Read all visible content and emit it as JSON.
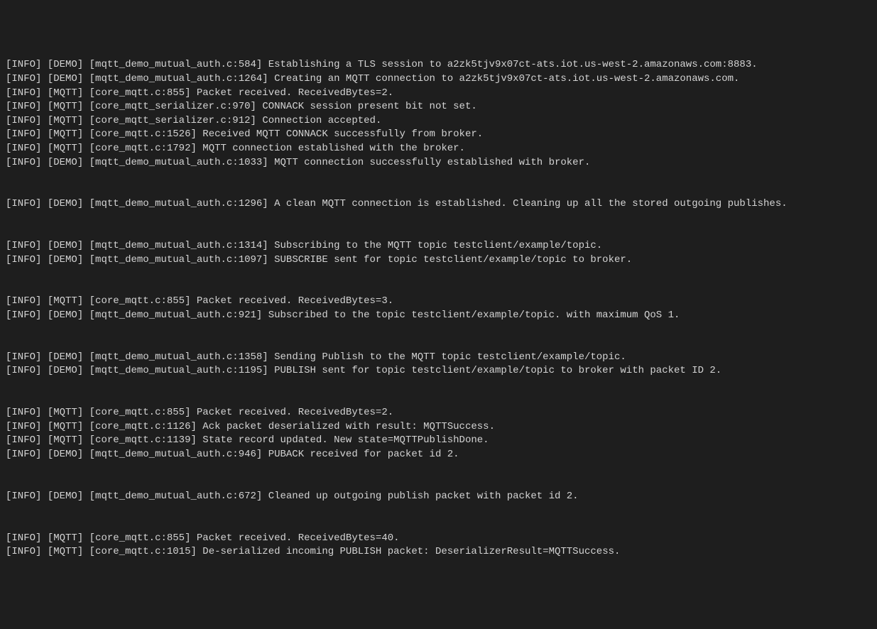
{
  "log_lines": [
    {
      "level": "[INFO]",
      "tag": "[DEMO]",
      "loc": "[mqtt_demo_mutual_auth.c:584]",
      "msg": "Establishing a TLS session to a2zk5tjv9x07ct-ats.iot.us-west-2.amazonaws.com:8883."
    },
    {
      "level": "[INFO]",
      "tag": "[DEMO]",
      "loc": "[mqtt_demo_mutual_auth.c:1264]",
      "msg": "Creating an MQTT connection to a2zk5tjv9x07ct-ats.iot.us-west-2.amazonaws.com."
    },
    {
      "level": "[INFO]",
      "tag": "[MQTT]",
      "loc": "[core_mqtt.c:855]",
      "msg": "Packet received. ReceivedBytes=2."
    },
    {
      "level": "[INFO]",
      "tag": "[MQTT]",
      "loc": "[core_mqtt_serializer.c:970]",
      "msg": "CONNACK session present bit not set."
    },
    {
      "level": "[INFO]",
      "tag": "[MQTT]",
      "loc": "[core_mqtt_serializer.c:912]",
      "msg": "Connection accepted."
    },
    {
      "level": "[INFO]",
      "tag": "[MQTT]",
      "loc": "[core_mqtt.c:1526]",
      "msg": "Received MQTT CONNACK successfully from broker."
    },
    {
      "level": "[INFO]",
      "tag": "[MQTT]",
      "loc": "[core_mqtt.c:1792]",
      "msg": "MQTT connection established with the broker."
    },
    {
      "level": "[INFO]",
      "tag": "[DEMO]",
      "loc": "[mqtt_demo_mutual_auth.c:1033]",
      "msg": "MQTT connection successfully established with broker."
    },
    {
      "blank": true
    },
    {
      "blank": true
    },
    {
      "level": "[INFO]",
      "tag": "[DEMO]",
      "loc": "[mqtt_demo_mutual_auth.c:1296]",
      "msg": "A clean MQTT connection is established. Cleaning up all the stored outgoing publishes."
    },
    {
      "blank": true
    },
    {
      "blank": true
    },
    {
      "level": "[INFO]",
      "tag": "[DEMO]",
      "loc": "[mqtt_demo_mutual_auth.c:1314]",
      "msg": "Subscribing to the MQTT topic testclient/example/topic."
    },
    {
      "level": "[INFO]",
      "tag": "[DEMO]",
      "loc": "[mqtt_demo_mutual_auth.c:1097]",
      "msg": "SUBSCRIBE sent for topic testclient/example/topic to broker."
    },
    {
      "blank": true
    },
    {
      "blank": true
    },
    {
      "level": "[INFO]",
      "tag": "[MQTT]",
      "loc": "[core_mqtt.c:855]",
      "msg": "Packet received. ReceivedBytes=3."
    },
    {
      "level": "[INFO]",
      "tag": "[DEMO]",
      "loc": "[mqtt_demo_mutual_auth.c:921]",
      "msg": "Subscribed to the topic testclient/example/topic. with maximum QoS 1."
    },
    {
      "blank": true
    },
    {
      "blank": true
    },
    {
      "level": "[INFO]",
      "tag": "[DEMO]",
      "loc": "[mqtt_demo_mutual_auth.c:1358]",
      "msg": "Sending Publish to the MQTT topic testclient/example/topic."
    },
    {
      "level": "[INFO]",
      "tag": "[DEMO]",
      "loc": "[mqtt_demo_mutual_auth.c:1195]",
      "msg": "PUBLISH sent for topic testclient/example/topic to broker with packet ID 2."
    },
    {
      "blank": true
    },
    {
      "blank": true
    },
    {
      "level": "[INFO]",
      "tag": "[MQTT]",
      "loc": "[core_mqtt.c:855]",
      "msg": "Packet received. ReceivedBytes=2."
    },
    {
      "level": "[INFO]",
      "tag": "[MQTT]",
      "loc": "[core_mqtt.c:1126]",
      "msg": "Ack packet deserialized with result: MQTTSuccess."
    },
    {
      "level": "[INFO]",
      "tag": "[MQTT]",
      "loc": "[core_mqtt.c:1139]",
      "msg": "State record updated. New state=MQTTPublishDone."
    },
    {
      "level": "[INFO]",
      "tag": "[DEMO]",
      "loc": "[mqtt_demo_mutual_auth.c:946]",
      "msg": "PUBACK received for packet id 2."
    },
    {
      "blank": true
    },
    {
      "blank": true
    },
    {
      "level": "[INFO]",
      "tag": "[DEMO]",
      "loc": "[mqtt_demo_mutual_auth.c:672]",
      "msg": "Cleaned up outgoing publish packet with packet id 2."
    },
    {
      "blank": true
    },
    {
      "blank": true
    },
    {
      "level": "[INFO]",
      "tag": "[MQTT]",
      "loc": "[core_mqtt.c:855]",
      "msg": "Packet received. ReceivedBytes=40."
    },
    {
      "level": "[INFO]",
      "tag": "[MQTT]",
      "loc": "[core_mqtt.c:1015]",
      "msg": "De-serialized incoming PUBLISH packet: DeserializerResult=MQTTSuccess."
    }
  ]
}
